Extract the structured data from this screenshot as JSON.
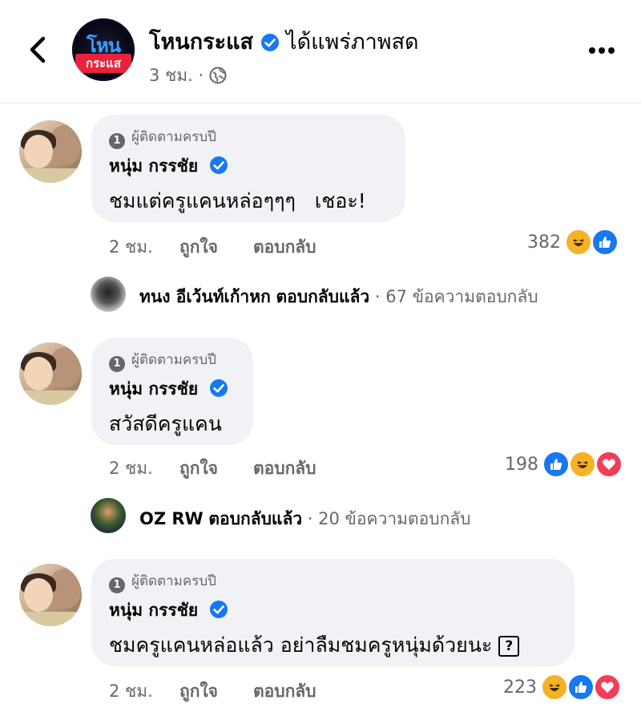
{
  "header": {
    "page_name": "โหนกระแส",
    "action": "ได้แพร่ภาพสด",
    "time": "3 ชม. ·",
    "logo_line1": "โหน",
    "logo_line2": "กระแส"
  },
  "comments": [
    {
      "badge": "ผู้ติดตามครบปี",
      "author": "หนุ่ม กรรชัย",
      "text": "ชมแต่ครูแคนหล่อๆๆๆ   เชอะ!",
      "has_emoji": false,
      "time": "2 ชม.",
      "like_label": "ถูกใจ",
      "reply_label": "ตอบกลับ",
      "reaction_count": "382",
      "reactions": [
        "haha-icon",
        "like-icon"
      ],
      "reply_preview": {
        "author": "ทนง อีเว้นท์เก้าหก",
        "action": "ตอบกลับแล้ว",
        "count": "· 67 ข้อความตอบกลับ"
      }
    },
    {
      "badge": "ผู้ติดตามครบปี",
      "author": "หนุ่ม กรรชัย",
      "text": "สวัสดีครูแคน",
      "has_emoji": false,
      "time": "2 ชม.",
      "like_label": "ถูกใจ",
      "reply_label": "ตอบกลับ",
      "reaction_count": "198",
      "reactions": [
        "like-icon",
        "haha-icon",
        "love-icon"
      ],
      "reply_preview": {
        "author": "OZ RW",
        "action": "ตอบกลับแล้ว",
        "count": "· 20 ข้อความตอบกลับ"
      }
    },
    {
      "badge": "ผู้ติดตามครบปี",
      "author": "หนุ่ม กรรชัย",
      "text": "ชมครูแคนหล่อแล้ว อย่าลืมชมครูหนุ่มด้วยนะ",
      "emoji": "?",
      "time": "2 ชม.",
      "like_label": "ถูกใจ",
      "reply_label": "ตอบกลับ",
      "reaction_count": "223",
      "reactions": [
        "haha-icon",
        "like-icon",
        "love-icon"
      ]
    }
  ],
  "colors": {
    "verified": "#1877f2",
    "bubble": "#f0f2f5",
    "meta": "#65676b"
  }
}
